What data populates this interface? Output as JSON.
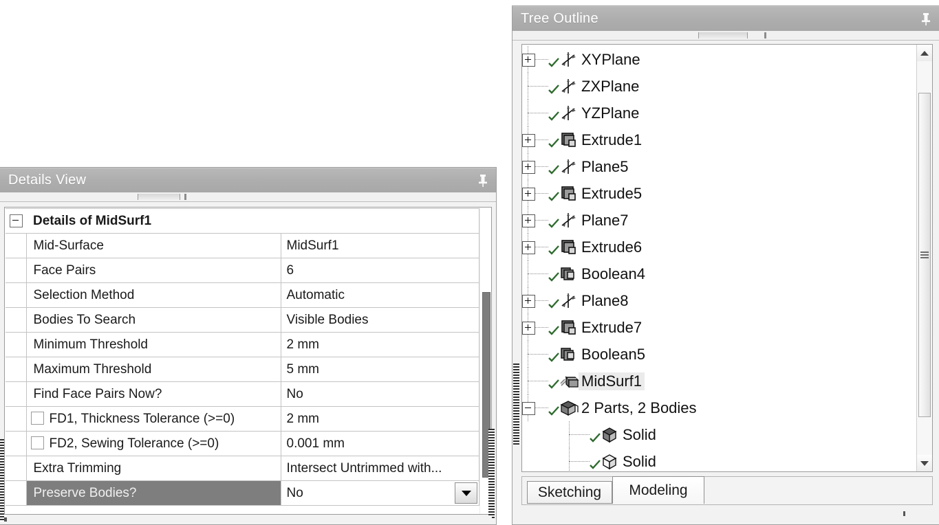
{
  "details_view": {
    "title": "Details View",
    "pin_icon": "pushpin-icon",
    "group": {
      "label": "Details of MidSurf1",
      "expander": "minus"
    },
    "rows": [
      {
        "property": "Mid-Surface",
        "value": "MidSurf1",
        "checkbox": false,
        "selected": false,
        "dropdown": false
      },
      {
        "property": "Face Pairs",
        "value": "6",
        "checkbox": false,
        "selected": false,
        "dropdown": false
      },
      {
        "property": "Selection Method",
        "value": "Automatic",
        "checkbox": false,
        "selected": false,
        "dropdown": false
      },
      {
        "property": "Bodies To Search",
        "value": "Visible Bodies",
        "checkbox": false,
        "selected": false,
        "dropdown": false
      },
      {
        "property": "Minimum Threshold",
        "value": "2 mm",
        "checkbox": false,
        "selected": false,
        "dropdown": false
      },
      {
        "property": "Maximum Threshold",
        "value": "5 mm",
        "checkbox": false,
        "selected": false,
        "dropdown": false
      },
      {
        "property": "Find Face Pairs Now?",
        "value": "No",
        "checkbox": false,
        "selected": false,
        "dropdown": false
      },
      {
        "property": "FD1, Thickness Tolerance (>=0)",
        "value": "2 mm",
        "checkbox": true,
        "selected": false,
        "dropdown": false
      },
      {
        "property": "FD2, Sewing Tolerance (>=0)",
        "value": "0.001 mm",
        "checkbox": true,
        "selected": false,
        "dropdown": false
      },
      {
        "property": "Extra Trimming",
        "value": "Intersect Untrimmed with...",
        "checkbox": false,
        "selected": false,
        "dropdown": false
      },
      {
        "property": "Preserve Bodies?",
        "value": "No",
        "checkbox": false,
        "selected": true,
        "dropdown": true
      }
    ]
  },
  "tree_outline": {
    "title": "Tree Outline",
    "pin_icon": "pushpin-icon",
    "items": [
      {
        "label": "XYPlane",
        "icon": "plane-icon",
        "expander": "plus",
        "check": true,
        "level": 1,
        "selected": false
      },
      {
        "label": "ZXPlane",
        "icon": "plane-icon",
        "expander": "none",
        "check": true,
        "level": 1,
        "selected": false
      },
      {
        "label": "YZPlane",
        "icon": "plane-icon",
        "expander": "none",
        "check": true,
        "level": 1,
        "selected": false
      },
      {
        "label": "Extrude1",
        "icon": "extrude-icon",
        "expander": "plus",
        "check": true,
        "level": 1,
        "selected": false
      },
      {
        "label": "Plane5",
        "icon": "plane-icon",
        "expander": "plus",
        "check": true,
        "level": 1,
        "selected": false
      },
      {
        "label": "Extrude5",
        "icon": "extrude-icon",
        "expander": "plus",
        "check": true,
        "level": 1,
        "selected": false
      },
      {
        "label": "Plane7",
        "icon": "plane-icon",
        "expander": "plus",
        "check": true,
        "level": 1,
        "selected": false
      },
      {
        "label": "Extrude6",
        "icon": "extrude-icon",
        "expander": "plus",
        "check": true,
        "level": 1,
        "selected": false
      },
      {
        "label": "Boolean4",
        "icon": "boolean-icon",
        "expander": "none",
        "check": true,
        "level": 1,
        "selected": false
      },
      {
        "label": "Plane8",
        "icon": "plane-icon",
        "expander": "plus",
        "check": true,
        "level": 1,
        "selected": false
      },
      {
        "label": "Extrude7",
        "icon": "extrude-icon",
        "expander": "plus",
        "check": true,
        "level": 1,
        "selected": false
      },
      {
        "label": "Boolean5",
        "icon": "boolean-icon",
        "expander": "none",
        "check": true,
        "level": 1,
        "selected": false
      },
      {
        "label": "MidSurf1",
        "icon": "midsurface-icon",
        "expander": "none",
        "check": true,
        "level": 1,
        "selected": true
      },
      {
        "label": "2 Parts, 2 Bodies",
        "icon": "parts-icon",
        "expander": "minus",
        "check": true,
        "level": 1,
        "selected": false
      },
      {
        "label": "Solid",
        "icon": "solid-icon",
        "expander": "none",
        "check": true,
        "level": 2,
        "selected": false
      },
      {
        "label": "Solid",
        "icon": "surface-icon",
        "expander": "none",
        "check": true,
        "level": 2,
        "selected": false
      }
    ],
    "tabs": [
      {
        "label": "Sketching",
        "active": false
      },
      {
        "label": "Modeling",
        "active": true
      }
    ],
    "scrollbar": {
      "up_icon": "scroll-up-arrow-icon",
      "down_icon": "scroll-down-arrow-icon"
    }
  },
  "colors": {
    "header_bg": "#ADADAD",
    "header_text": "#FFFFFF",
    "selected_row_bg": "#7E7E7E",
    "tree_selected_bg": "#EBEBEB",
    "check_green": "#2F6B2F",
    "panel_bg": "#F2F2F2"
  }
}
